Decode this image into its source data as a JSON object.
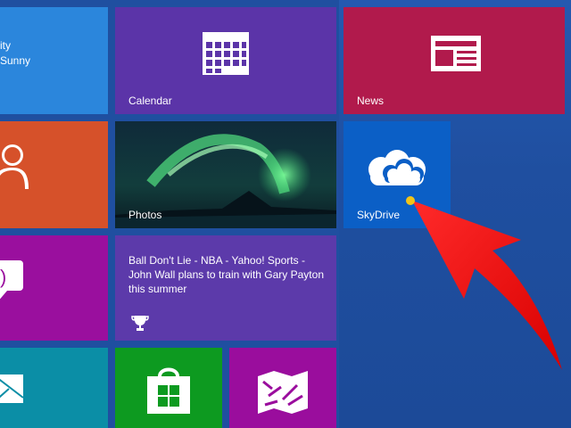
{
  "tiles": {
    "weather": {
      "line1": "ity",
      "line2": "Sunny"
    },
    "calendar": {
      "label": "Calendar",
      "icon": "calendar-icon"
    },
    "news": {
      "label": "News",
      "icon": "newspaper-icon"
    },
    "people": {
      "icon": "people-icon"
    },
    "photos": {
      "label": "Photos"
    },
    "skydrive": {
      "label": "SkyDrive",
      "icon": "cloud-icon"
    },
    "messaging": {
      "icon": "messaging-icon"
    },
    "sports": {
      "headline": "Ball Don't Lie - NBA  - Yahoo! Sports - John Wall plans to train with Gary Payton this summer",
      "icon": "trophy-icon"
    },
    "mail": {
      "icon": "mail-icon"
    },
    "store": {
      "icon": "store-icon"
    },
    "maps": {
      "icon": "maps-icon"
    }
  },
  "colors": {
    "background": "#1f4fa0",
    "calendar": "#5b34a8",
    "news": "#b11a4c",
    "people": "#d6512a",
    "skydrive": "#0b5fc6",
    "messaging": "#9a0f9e",
    "sports": "#5c3aaa",
    "mail": "#0b8ea6",
    "store": "#0d9a20",
    "maps": "#9a0d9d",
    "annotation_arrow": "#ff1a1a"
  }
}
